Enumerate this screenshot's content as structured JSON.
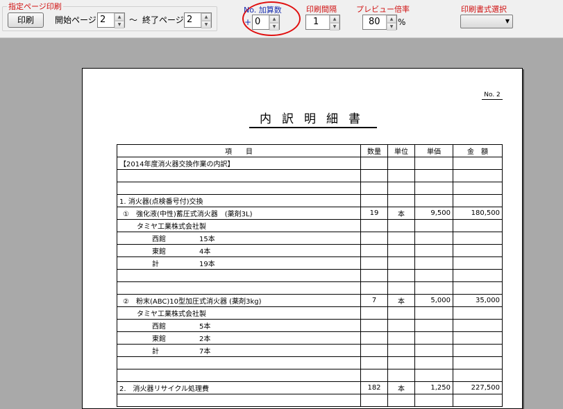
{
  "toolbar": {
    "page_print_group": "指定ページ印刷",
    "print_button": "印刷",
    "start_page_label": "開始ページ",
    "start_page_value": "2",
    "tilde": "～",
    "end_page_label": "終了ページ",
    "end_page_value": "2",
    "no_add_label": "No. 加算数",
    "plus": "+",
    "no_add_value": "0",
    "print_interval_label": "印刷間隔",
    "print_interval_value": "1",
    "preview_zoom_label": "プレビュー倍率",
    "preview_zoom_value": "80",
    "percent": "%",
    "print_format_label": "印刷書式選択"
  },
  "document": {
    "page_no": "No. 2",
    "title": "内訳明細書",
    "headers": [
      "項　　目",
      "数量",
      "単位",
      "単価",
      "金　額"
    ],
    "rows": [
      {
        "item": "【2014年度消火器交換作業の内訳】",
        "indent": 0,
        "qty": "",
        "unit": "",
        "price": "",
        "amount": ""
      },
      {
        "item": "",
        "indent": 0,
        "qty": "",
        "unit": "",
        "price": "",
        "amount": ""
      },
      {
        "item": "",
        "indent": 0,
        "qty": "",
        "unit": "",
        "price": "",
        "amount": ""
      },
      {
        "item": "1. 消火器(点検番号付)交換",
        "indent": 0,
        "qty": "",
        "unit": "",
        "price": "",
        "amount": ""
      },
      {
        "item": "①　強化液(中性)蓄圧式消火器　(薬剤3L)",
        "indent": 1,
        "qty": "19",
        "unit": "本",
        "price": "9,500",
        "amount": "180,500"
      },
      {
        "item": "タミヤ工業株式会社製",
        "indent": 2,
        "qty": "",
        "unit": "",
        "price": "",
        "amount": ""
      },
      {
        "item": "西館",
        "sub": "15本",
        "indent": 3,
        "qty": "",
        "unit": "",
        "price": "",
        "amount": ""
      },
      {
        "item": "東館",
        "sub": "4本",
        "indent": 3,
        "qty": "",
        "unit": "",
        "price": "",
        "amount": ""
      },
      {
        "item": "計",
        "sub": "19本",
        "indent": 3,
        "qty": "",
        "unit": "",
        "price": "",
        "amount": ""
      },
      {
        "item": "",
        "indent": 0,
        "qty": "",
        "unit": "",
        "price": "",
        "amount": ""
      },
      {
        "item": "",
        "indent": 0,
        "qty": "",
        "unit": "",
        "price": "",
        "amount": ""
      },
      {
        "item": "②　粉末(ABC)10型加圧式消火器 (薬剤3kg)",
        "indent": 1,
        "qty": "7",
        "unit": "本",
        "price": "5,000",
        "amount": "35,000"
      },
      {
        "item": "タミヤ工業株式会社製",
        "indent": 2,
        "qty": "",
        "unit": "",
        "price": "",
        "amount": ""
      },
      {
        "item": "西館",
        "sub": "5本",
        "indent": 3,
        "qty": "",
        "unit": "",
        "price": "",
        "amount": ""
      },
      {
        "item": "東館",
        "sub": "2本",
        "indent": 3,
        "qty": "",
        "unit": "",
        "price": "",
        "amount": ""
      },
      {
        "item": "計",
        "sub": "7本",
        "indent": 3,
        "qty": "",
        "unit": "",
        "price": "",
        "amount": ""
      },
      {
        "item": "",
        "indent": 0,
        "qty": "",
        "unit": "",
        "price": "",
        "amount": ""
      },
      {
        "item": "",
        "indent": 0,
        "qty": "",
        "unit": "",
        "price": "",
        "amount": ""
      },
      {
        "item": "2.　消火器リサイクル処理費",
        "indent": 0,
        "qty": "182",
        "unit": "本",
        "price": "1,250",
        "amount": "227,500"
      },
      {
        "item": "",
        "indent": 0,
        "qty": "",
        "unit": "",
        "price": "",
        "amount": ""
      }
    ]
  }
}
